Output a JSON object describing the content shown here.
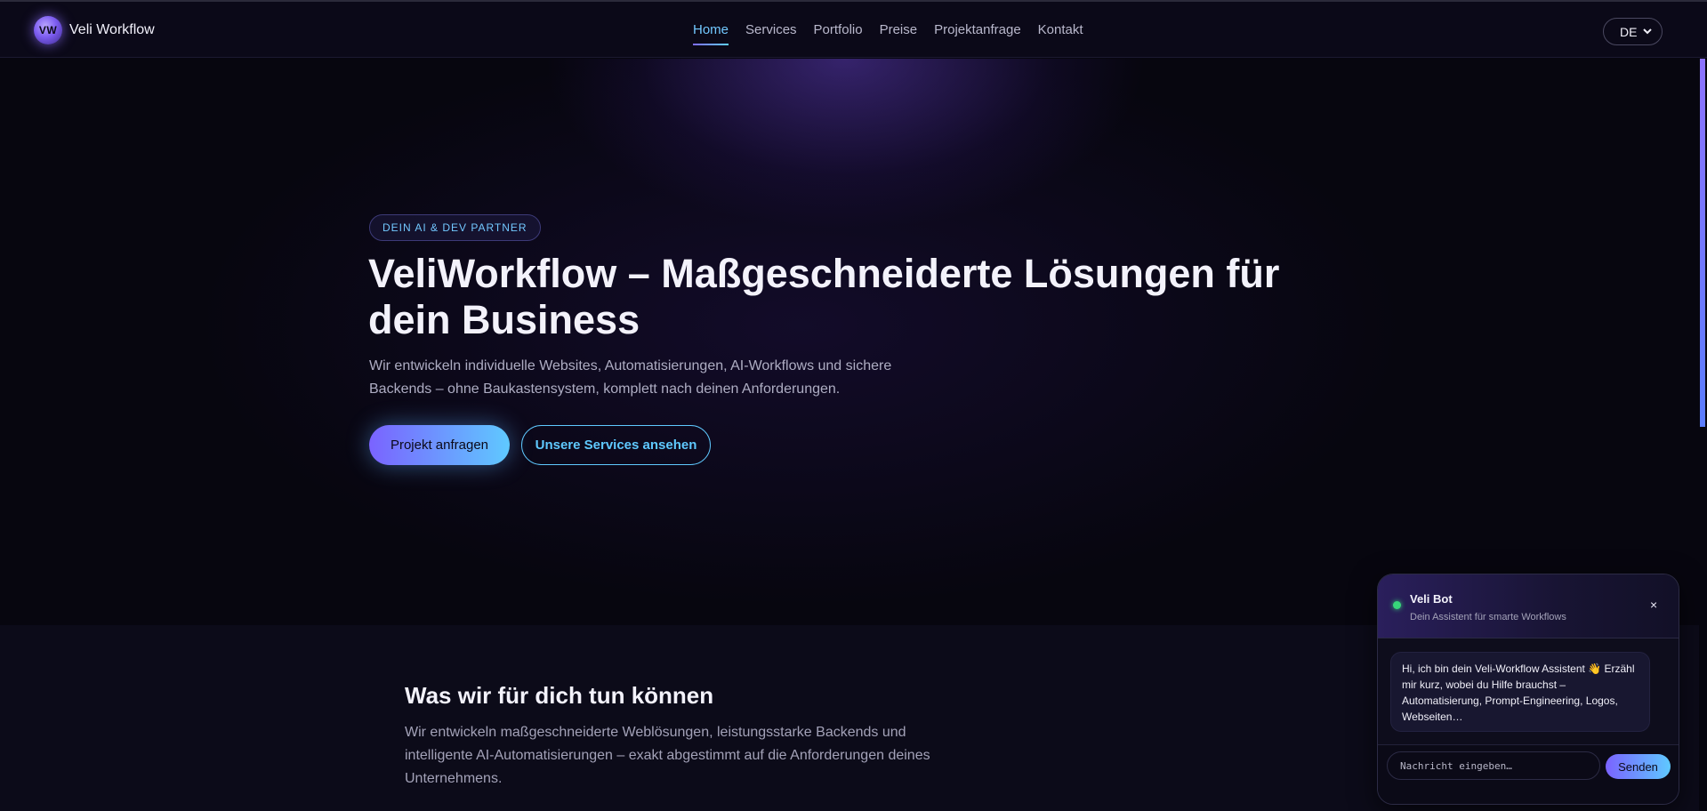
{
  "brand": {
    "logo_text": "VW",
    "name": "Veli Workflow"
  },
  "nav": {
    "links": [
      {
        "label": "Home",
        "active": true
      },
      {
        "label": "Services",
        "active": false
      },
      {
        "label": "Portfolio",
        "active": false
      },
      {
        "label": "Preise",
        "active": false
      },
      {
        "label": "Projektanfrage",
        "active": false
      },
      {
        "label": "Kontakt",
        "active": false
      }
    ],
    "language": "DE"
  },
  "hero": {
    "badge": "DEIN AI & DEV PARTNER",
    "title": "VeliWorkflow – Maßgeschneiderte Lösungen für dein Business",
    "subtitle": "Wir entwickeln individuelle Websites, Automatisierungen, AI-Workflows und sichere Backends – ohne Baukastensystem, komplett nach deinen Anforderungen.",
    "primary_button": "Projekt anfragen",
    "secondary_button": "Unsere Services ansehen"
  },
  "services": {
    "title": "Was wir für dich tun können",
    "description": "Wir entwickeln maßgeschneiderte Weblösungen, leistungsstarke Backends und intelligente AI-Automatisierungen – exakt abgestimmt auf die Anforderungen deines Unternehmens."
  },
  "chat": {
    "bot_name": "Veli Bot",
    "tagline": "Dein Assistent für smarte Workflows",
    "close": "×",
    "message": "Hi, ich bin dein Veli-Workflow Assistent 👋 Erzähl mir kurz, wobei du Hilfe brauchst – Automatisierung, Prompt-Engineering, Logos, Webseiten…",
    "input_placeholder": "Nachricht eingeben…",
    "send_label": "Senden"
  },
  "colors": {
    "background": "#07060f",
    "accent_purple": "#7a63ff",
    "accent_cyan": "#5fc9ff",
    "status_online": "#37d67a"
  }
}
